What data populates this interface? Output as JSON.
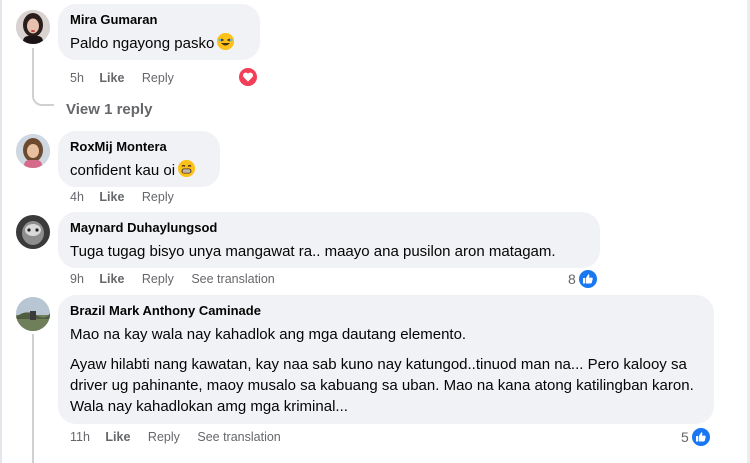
{
  "colors": {
    "bubble": "#f0f2f5",
    "meta": "#65676b",
    "like": "#1877f2",
    "love": "#f33e58"
  },
  "comments": [
    {
      "author": "Mira Gumaran",
      "text": "Paldo ngayong pasko",
      "emoji": "laughing-emoji",
      "time": "5h",
      "like": "Like",
      "reply": "Reply",
      "reaction": "love-icon"
    },
    {
      "author": "RoxMij Montera",
      "text": "confident kau oi",
      "emoji": "grinning-emoji",
      "time": "4h",
      "like": "Like",
      "reply": "Reply"
    },
    {
      "author": "Maynard Duhaylungsod",
      "text": "Tuga tugag bisyo unya mangawat ra.. maayo ana pusilon aron matagam.",
      "time": "9h",
      "like": "Like",
      "reply": "Reply",
      "see_translation": "See translation",
      "reaction_count": "8",
      "reaction": "like-icon"
    },
    {
      "author": "Brazil Mark Anthony Caminade",
      "paragraphs": [
        "Mao na kay wala nay kahadlok ang mga dautang elemento.",
        "Ayaw hilabti nang kawatan, kay naa sab kuno nay katungod..tinuod man na... Pero kalooy sa driver ug pahinante, maoy musalo sa kabuang sa uban. Mao na kana atong katilingban karon. Wala nay kahadlokan amg mga kriminal..."
      ],
      "time": "11h",
      "like": "Like",
      "reply": "Reply",
      "see_translation": "See translation",
      "reaction_count": "5",
      "reaction": "like-icon"
    }
  ],
  "view_replies": "View 1 reply"
}
